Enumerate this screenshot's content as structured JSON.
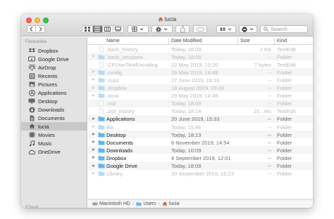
{
  "window": {
    "title": "lucia"
  },
  "toolbar": {
    "search_placeholder": "Search"
  },
  "sidebar": {
    "sections": [
      {
        "label": "Favourites"
      },
      {
        "label": "iCloud"
      }
    ],
    "items": [
      {
        "label": "Dropbox",
        "icon": "dropbox-icon"
      },
      {
        "label": "Google Drive",
        "icon": "google-drive-icon"
      },
      {
        "label": "AirDrop",
        "icon": "airdrop-icon"
      },
      {
        "label": "Recents",
        "icon": "recents-icon"
      },
      {
        "label": "Pictures",
        "icon": "pictures-icon"
      },
      {
        "label": "Applications",
        "icon": "applications-icon"
      },
      {
        "label": "Desktop",
        "icon": "desktop-icon"
      },
      {
        "label": "Downloads",
        "icon": "downloads-icon"
      },
      {
        "label": "Documents",
        "icon": "documents-icon"
      },
      {
        "label": "lucia",
        "icon": "home-icon",
        "selected": true
      },
      {
        "label": "Movies",
        "icon": "movies-icon"
      },
      {
        "label": "Music",
        "icon": "music-icon"
      },
      {
        "label": "OneDrive",
        "icon": "onedrive-icon"
      }
    ]
  },
  "columns": {
    "name": "Name",
    "date": "Date Modified",
    "size": "Size",
    "kind": "Kind"
  },
  "files": [
    {
      "name": ".bash_history",
      "date": "Today, 18:09",
      "size": "2 KB",
      "kind": "TextEdit",
      "hidden": true,
      "folder": false,
      "expandable": false
    },
    {
      "name": ".bash_sessions",
      "date": "Today, 18:09",
      "size": "--",
      "kind": "Folder",
      "hidden": true,
      "folder": true,
      "expandable": true
    },
    {
      "name": ".CFUserTextEncoding",
      "date": "22 May 2019, 10:20",
      "size": "7 bytes",
      "kind": "TextEdit",
      "hidden": true,
      "folder": false,
      "expandable": false
    },
    {
      "name": ".config",
      "date": "29 May 2019, 14:48",
      "size": "--",
      "kind": "Folder",
      "hidden": true,
      "folder": true,
      "expandable": true
    },
    {
      "name": ".cups",
      "date": "27 June 2019, 18:10",
      "size": "--",
      "kind": "Folder",
      "hidden": true,
      "folder": true,
      "expandable": true
    },
    {
      "name": ".dropbox",
      "date": "19 August 2019, 09:24",
      "size": "--",
      "kind": "Folder",
      "hidden": true,
      "folder": true,
      "expandable": true
    },
    {
      "name": ".local",
      "date": "29 May 2019, 14:48",
      "size": "--",
      "kind": "Folder",
      "hidden": true,
      "folder": true,
      "expandable": true
    },
    {
      "name": ".rnd",
      "date": "Today, 18:09",
      "size": "--",
      "kind": "Folder",
      "hidden": true,
      "folder": false,
      "expandable": false
    },
    {
      "name": ".zsh_history",
      "date": "Today, 18:14",
      "size": "21...tes",
      "kind": "TextEdit",
      "hidden": true,
      "folder": false,
      "expandable": false
    },
    {
      "name": "Applications",
      "date": "20 June 2019, 15:33",
      "size": "--",
      "kind": "Folder",
      "hidden": false,
      "folder": true,
      "expandable": true
    },
    {
      "name": "Bin",
      "date": "Today, 15:46",
      "size": "--",
      "kind": "Folder",
      "hidden": true,
      "folder": true,
      "expandable": true
    },
    {
      "name": "Desktop",
      "date": "Today, 18:13",
      "size": "--",
      "kind": "Folder",
      "hidden": false,
      "folder": true,
      "expandable": true
    },
    {
      "name": "Documents",
      "date": "6 November 2019, 14:54",
      "size": "--",
      "kind": "Folder",
      "hidden": false,
      "folder": true,
      "expandable": true
    },
    {
      "name": "Downloads",
      "date": "Today, 10:09",
      "size": "--",
      "kind": "Folder",
      "hidden": false,
      "folder": true,
      "expandable": true
    },
    {
      "name": "Dropbox",
      "date": "4 September 2019, 12:01",
      "size": "--",
      "kind": "Folder",
      "hidden": false,
      "folder": true,
      "expandable": true
    },
    {
      "name": "Google Drive",
      "date": "Today, 18:09",
      "size": "--",
      "kind": "Folder",
      "hidden": false,
      "folder": true,
      "expandable": true
    },
    {
      "name": "Library",
      "date": "20 September 2019, 15:23",
      "size": "--",
      "kind": "Folder",
      "hidden": true,
      "folder": true,
      "expandable": true
    }
  ],
  "pathbar": [
    {
      "label": "Macintosh HD",
      "icon": "hard-drive-icon"
    },
    {
      "label": "Users",
      "icon": "folder-icon"
    },
    {
      "label": "lucia",
      "icon": "home-icon"
    }
  ],
  "colors": {
    "folder": "#5eb7f3",
    "folder_dim": "#b9dbf5",
    "selected_sidebar": "#c9c8c9"
  }
}
